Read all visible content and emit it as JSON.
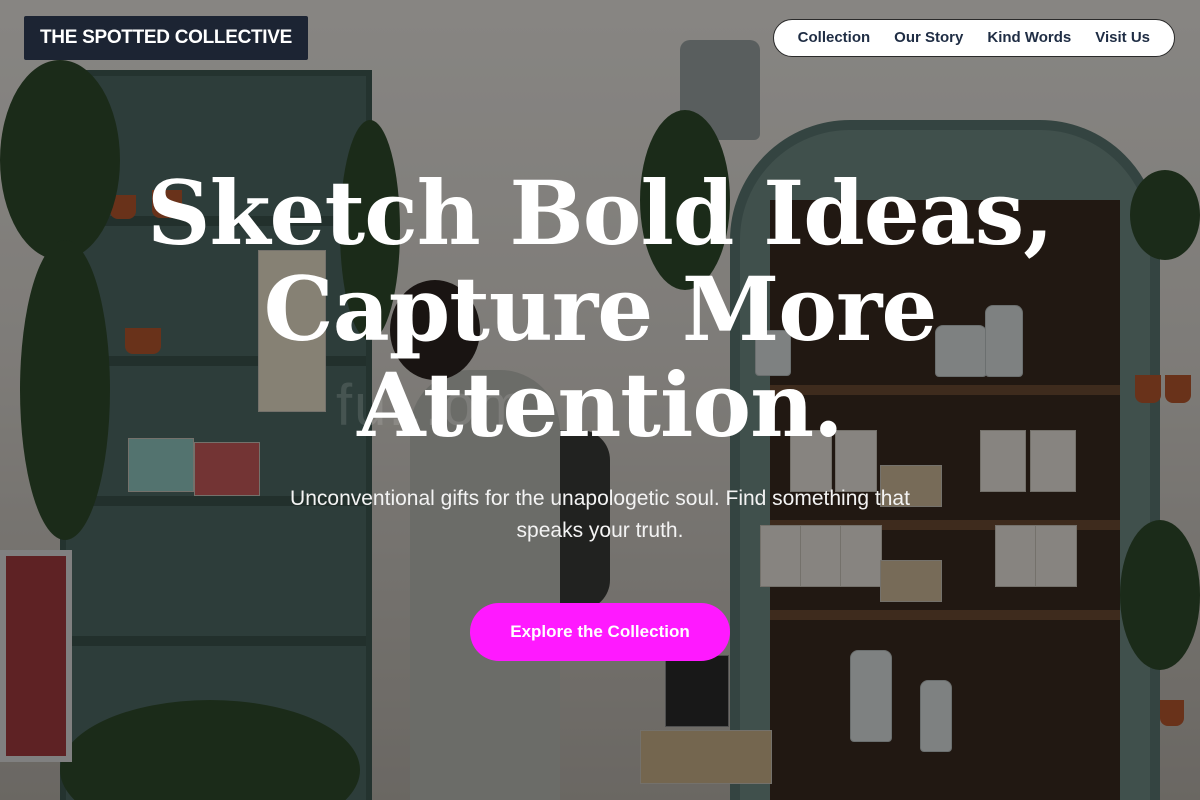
{
  "brand": {
    "name": "THE SPOTTED COLLECTIVE"
  },
  "nav": {
    "items": [
      {
        "label": "Collection"
      },
      {
        "label": "Our Story"
      },
      {
        "label": "Kind Words"
      },
      {
        "label": "Visit Us"
      }
    ]
  },
  "hero": {
    "headline_line1": "Sketch Bold Ideas,",
    "headline_line2": "Capture More",
    "headline_line3": "Attention.",
    "subtitle": "Unconventional gifts for the unapologetic soul. Find something that speaks your truth.",
    "cta_label": "Explore the Collection",
    "background_image": "shop interior with plants, dresser shelves of gifts and a browsing customer",
    "watermark": "fu...om"
  },
  "colors": {
    "brand_bg": "#1c2433",
    "nav_text": "#1f2d44",
    "cta_bg": "#ff19ff",
    "headline": "#ffffff"
  }
}
